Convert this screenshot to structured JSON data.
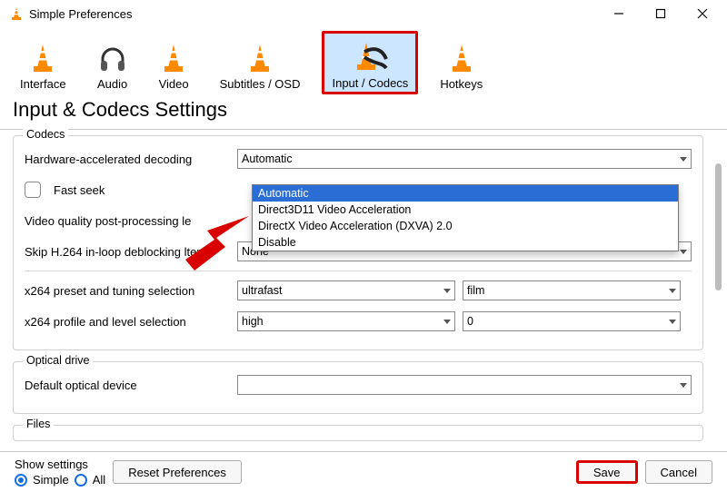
{
  "window": {
    "title": "Simple Preferences"
  },
  "tabs": {
    "interface": "Interface",
    "audio": "Audio",
    "video": "Video",
    "subtitles": "Subtitles / OSD",
    "input_codecs": "Input / Codecs",
    "hotkeys": "Hotkeys"
  },
  "heading": "Input & Codecs Settings",
  "groups": {
    "codecs": {
      "title": "Codecs",
      "hw_decoding_label": "Hardware-accelerated decoding",
      "hw_decoding_value": "Automatic",
      "hw_decoding_options": [
        "Automatic",
        "Direct3D11 Video Acceleration",
        "DirectX Video Acceleration (DXVA) 2.0",
        "Disable"
      ],
      "fast_seek_label": "Fast seek",
      "fast_seek_checked": false,
      "vq_post_label_visible": "Video quality post-processing le",
      "skip_h264_label_visible": "Skip H.264 in-loop deblocking    lter",
      "skip_h264_value": "None",
      "x264_preset_label": "x264 preset and tuning selection",
      "x264_preset_value": "ultrafast",
      "x264_tuning_value": "film",
      "x264_profile_label": "x264 profile and level selection",
      "x264_profile_value": "high",
      "x264_level_value": "0"
    },
    "optical": {
      "title": "Optical drive",
      "default_device_label": "Default optical device",
      "default_device_value": ""
    },
    "files": {
      "title": "Files"
    }
  },
  "bottom": {
    "show_settings_label": "Show settings",
    "simple_label": "Simple",
    "all_label": "All",
    "reset_label": "Reset Preferences",
    "save_label": "Save",
    "cancel_label": "Cancel"
  }
}
